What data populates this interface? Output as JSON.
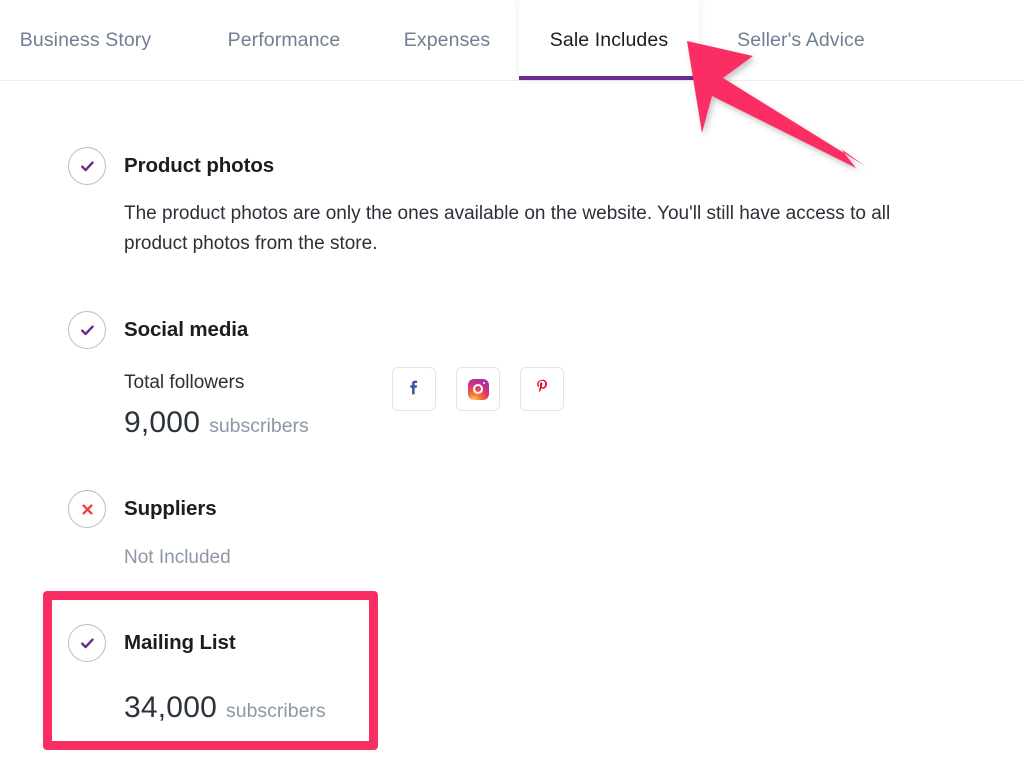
{
  "tabs": [
    {
      "id": "business-story",
      "label": "Business Story",
      "active": false
    },
    {
      "id": "performance",
      "label": "Performance",
      "active": false
    },
    {
      "id": "expenses",
      "label": "Expenses",
      "active": false
    },
    {
      "id": "sale-includes",
      "label": "Sale Includes",
      "active": true
    },
    {
      "id": "sellers-advice",
      "label": "Seller's Advice",
      "active": false
    }
  ],
  "colors": {
    "accent_purple": "#6b2d8c",
    "check_purple": "#6b2d8c",
    "cross_red": "#f03c3c",
    "annotation_pink": "#fa2e63",
    "tab_inactive": "#6f7f94",
    "tab_active": "#1b1d21",
    "muted_text": "#8d97a6",
    "facebook_blue": "#3b5998",
    "pinterest_red": "#e60023"
  },
  "sections": {
    "product_photos": {
      "status_icon": "check-circle-icon",
      "title": "Product photos",
      "body": "The product photos are only the ones available on the website. You'll still have access to all product photos from the store."
    },
    "social_media": {
      "status_icon": "check-circle-icon",
      "title": "Social media",
      "followers_label": "Total followers",
      "followers_count": "9,000",
      "followers_unit": "subscribers",
      "networks": [
        {
          "name": "facebook",
          "icon": "facebook-icon",
          "glyph": "f"
        },
        {
          "name": "instagram",
          "icon": "instagram-icon",
          "glyph": ""
        },
        {
          "name": "pinterest",
          "icon": "pinterest-icon",
          "glyph": "P"
        }
      ]
    },
    "suppliers": {
      "status_icon": "cross-circle-icon",
      "title": "Suppliers",
      "body": "Not Included"
    },
    "mailing_list": {
      "status_icon": "check-circle-icon",
      "title": "Mailing List",
      "count": "34,000",
      "unit": "subscribers",
      "highlighted": true
    }
  },
  "annotations": {
    "arrow": {
      "icon": "pointer-arrow-annotation",
      "points_to": "Sale Includes"
    },
    "box": {
      "icon": "highlight-box-annotation",
      "surrounds": "Mailing List"
    }
  }
}
